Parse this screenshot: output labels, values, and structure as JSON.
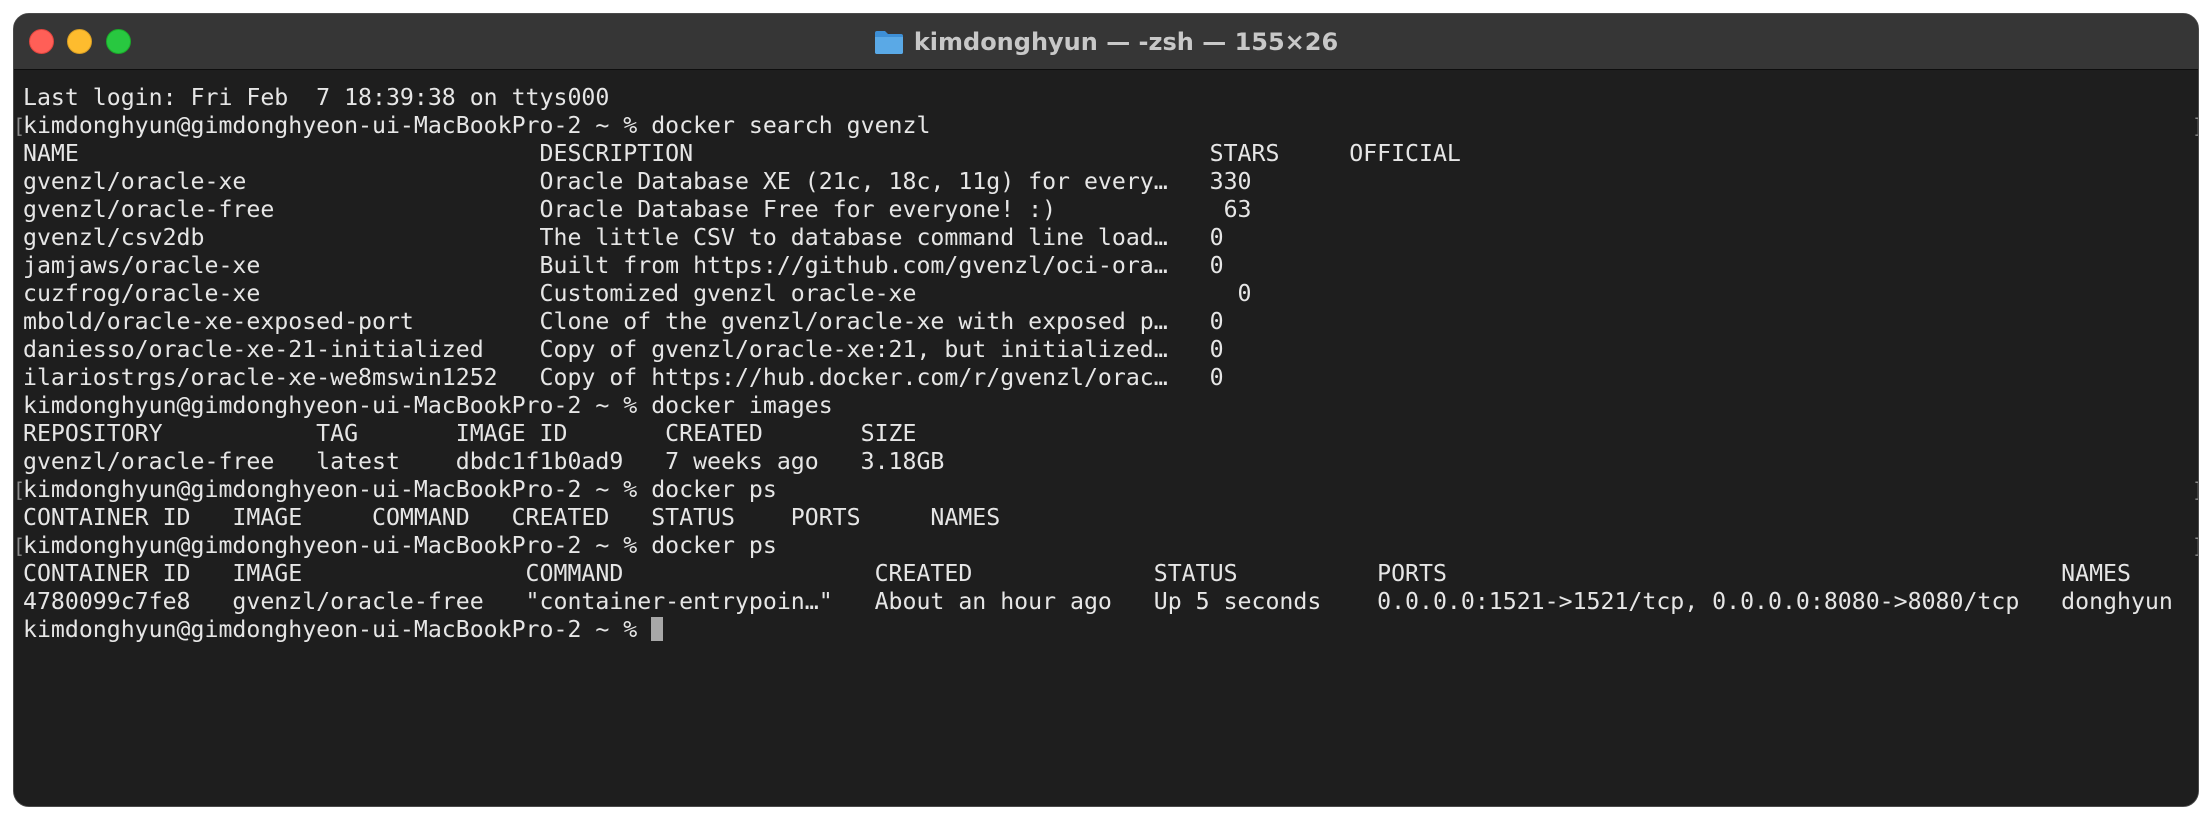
{
  "window": {
    "title": "kimdonghyun — -zsh — 155×26",
    "folder_icon": "folder-icon"
  },
  "colors": {
    "terminal_bg": "#1e1e1e",
    "titlebar_bg": "#363636",
    "text": "#e6e6e6",
    "close": "#ff5f57",
    "minimize": "#febc2e",
    "zoom": "#28c840",
    "folder": "#5aa9e6"
  },
  "terminal": {
    "lines": [
      "Last login: Fri Feb  7 18:39:38 on ttys000",
      "kimdonghyun@gimdonghyeon-ui-MacBookPro-2 ~ % docker search gvenzl",
      "NAME                                 DESCRIPTION                                     STARS     OFFICIAL",
      "gvenzl/oracle-xe                     Oracle Database XE (21c, 18c, 11g) for every…   330",
      "gvenzl/oracle-free                   Oracle Database Free for everyone! :)            63",
      "gvenzl/csv2db                        The little CSV to database command line load…   0",
      "jamjaws/oracle-xe                    Built from https://github.com/gvenzl/oci-ora…   0",
      "cuzfrog/oracle-xe                    Customized gvenzl oracle-xe                       0",
      "mbold/oracle-xe-exposed-port         Clone of the gvenzl/oracle-xe with exposed p…   0",
      "daniesso/oracle-xe-21-initialized    Copy of gvenzl/oracle-xe:21, but initialized…   0",
      "ilariostrgs/oracle-xe-we8mswin1252   Copy of https://hub.docker.com/r/gvenzl/orac…   0",
      "kimdonghyun@gimdonghyeon-ui-MacBookPro-2 ~ % docker images",
      "REPOSITORY           TAG       IMAGE ID       CREATED       SIZE",
      "gvenzl/oracle-free   latest    dbdc1f1b0ad9   7 weeks ago   3.18GB",
      "kimdonghyun@gimdonghyeon-ui-MacBookPro-2 ~ % docker ps",
      "CONTAINER ID   IMAGE     COMMAND   CREATED   STATUS    PORTS     NAMES",
      "kimdonghyun@gimdonghyeon-ui-MacBookPro-2 ~ % docker ps",
      "CONTAINER ID   IMAGE                COMMAND                  CREATED             STATUS          PORTS                                            NAMES",
      "4780099c7fe8   gvenzl/oracle-free   \"container-entrypoin…\"   About an hour ago   Up 5 seconds    0.0.0.0:1521->1521/tcp, 0.0.0.0:8080->8080/tcp   donghyun",
      "kimdonghyun@gimdonghyeon-ui-MacBookPro-2 ~ % "
    ],
    "marked_lines": [
      "1",
      "14",
      "16"
    ]
  }
}
